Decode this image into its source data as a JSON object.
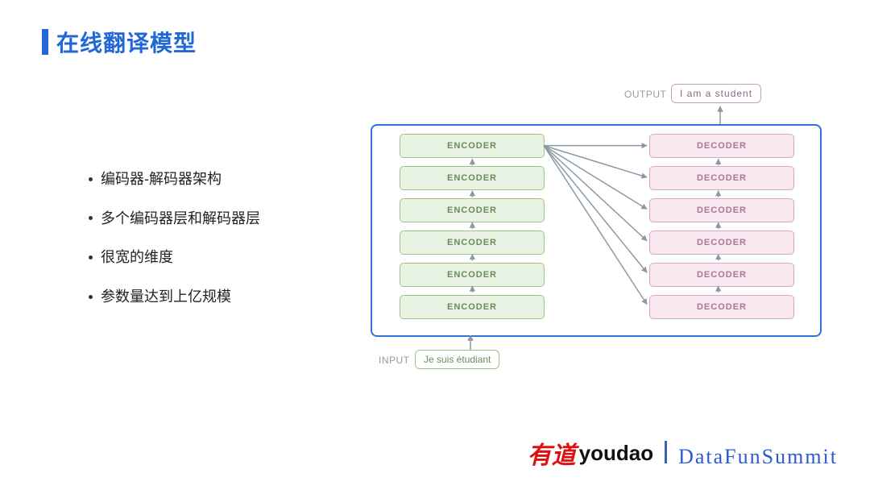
{
  "title": "在线翻译模型",
  "bullets": [
    "编码器-解码器架构",
    "多个编码器层和解码器层",
    "很宽的维度",
    "参数量达到上亿规模"
  ],
  "diagram": {
    "output_label": "OUTPUT",
    "output_text": "I   am   a   student",
    "input_label": "INPUT",
    "input_text": "Je   suis   étudiant",
    "encoder_labels": [
      "ENCODER",
      "ENCODER",
      "ENCODER",
      "ENCODER",
      "ENCODER",
      "ENCODER"
    ],
    "decoder_labels": [
      "DECODER",
      "DECODER",
      "DECODER",
      "DECODER",
      "DECODER",
      "DECODER"
    ]
  },
  "footer": {
    "youdao_cn": "有道",
    "youdao_en": "youdao",
    "event": "DataFunSummit"
  }
}
